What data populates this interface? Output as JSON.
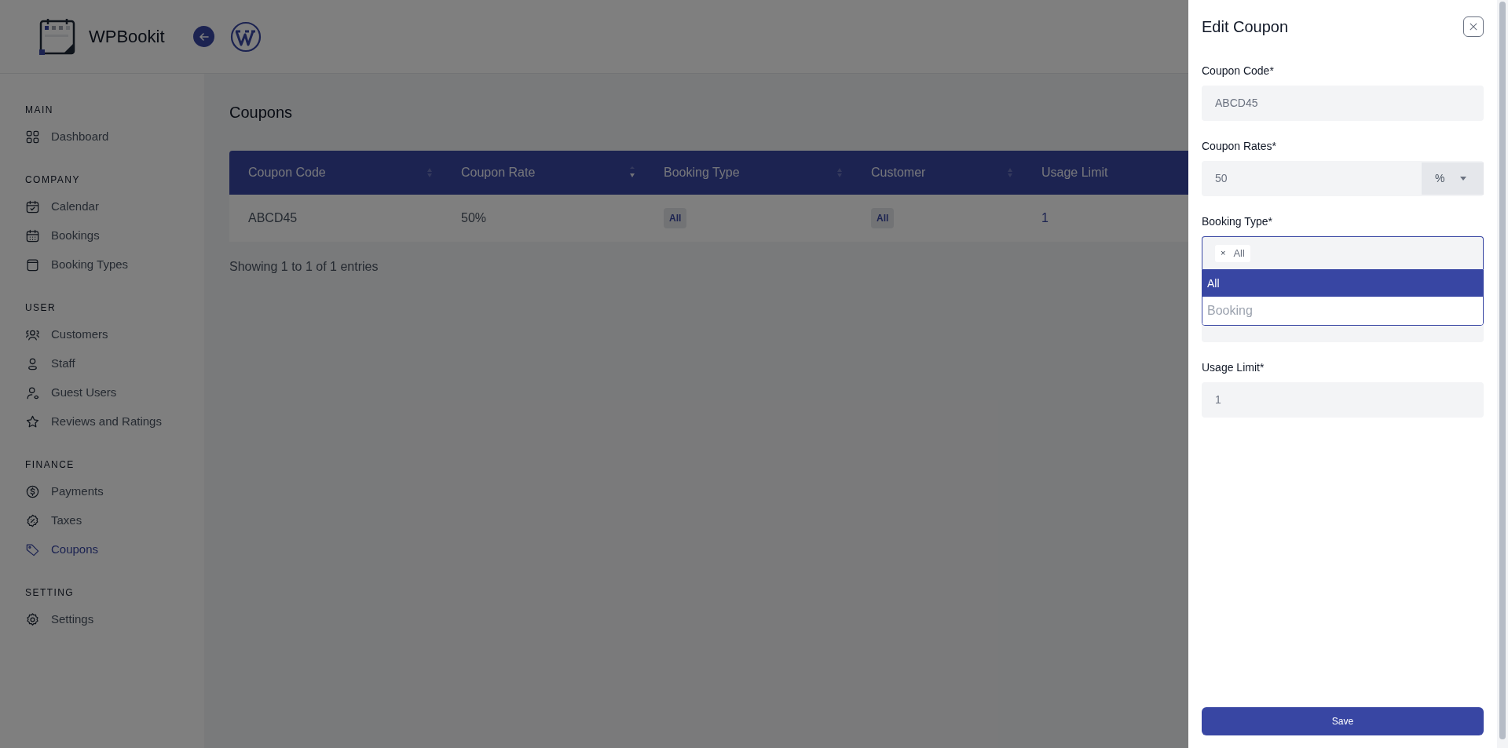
{
  "app": {
    "name": "WPBookit"
  },
  "sidebar": {
    "sections": [
      {
        "title": "MAIN",
        "items": [
          {
            "label": "Dashboard",
            "selected": false
          }
        ]
      },
      {
        "title": "COMPANY",
        "items": [
          {
            "label": "Calendar",
            "selected": false
          },
          {
            "label": "Bookings",
            "selected": false
          },
          {
            "label": "Booking Types",
            "selected": false
          }
        ]
      },
      {
        "title": "USER",
        "items": [
          {
            "label": "Customers",
            "selected": false
          },
          {
            "label": "Staff",
            "selected": false
          },
          {
            "label": "Guest Users",
            "selected": false
          },
          {
            "label": "Reviews and Ratings",
            "selected": false
          }
        ]
      },
      {
        "title": "FINANCE",
        "items": [
          {
            "label": "Payments",
            "selected": false
          },
          {
            "label": "Taxes",
            "selected": false
          },
          {
            "label": "Coupons",
            "selected": true
          }
        ]
      },
      {
        "title": "SETTING",
        "items": [
          {
            "label": "Settings",
            "selected": false
          }
        ]
      }
    ]
  },
  "page": {
    "title": "Coupons"
  },
  "table": {
    "columns": [
      {
        "label": "Coupon Code",
        "sortable": true,
        "sorted": false
      },
      {
        "label": "Coupon Rate",
        "sortable": true,
        "sorted": true
      },
      {
        "label": "Booking Type",
        "sortable": true,
        "sorted": false
      },
      {
        "label": "Customer",
        "sortable": true,
        "sorted": false
      },
      {
        "label": "Usage Limit"
      }
    ],
    "rows": [
      [
        {
          "kind": "text",
          "text": "ABCD45"
        },
        {
          "kind": "text",
          "text": "50%"
        },
        {
          "kind": "badge",
          "text": "All"
        },
        {
          "kind": "badge",
          "text": "All"
        },
        {
          "kind": "link",
          "text": "1"
        }
      ]
    ],
    "footer": "Showing 1 to 1 of 1 entries"
  },
  "drawer": {
    "title": "Edit Coupon",
    "fields": [
      {
        "kind": "text",
        "label": "Coupon Code*",
        "value": "ABCD45"
      },
      {
        "kind": "rate",
        "label": "Coupon Rates*",
        "value": "50",
        "unit": "%"
      },
      {
        "kind": "multiselect",
        "label": "Booking Type*",
        "chips": [
          {
            "remove": "×",
            "label": "All"
          }
        ],
        "open": true,
        "options": [
          {
            "label": "All",
            "selected": true
          },
          {
            "label": "Booking",
            "selected": false
          }
        ]
      },
      {
        "kind": "covered"
      },
      {
        "kind": "text",
        "label": "Usage Limit*",
        "value": "1"
      }
    ],
    "save": "Save"
  }
}
